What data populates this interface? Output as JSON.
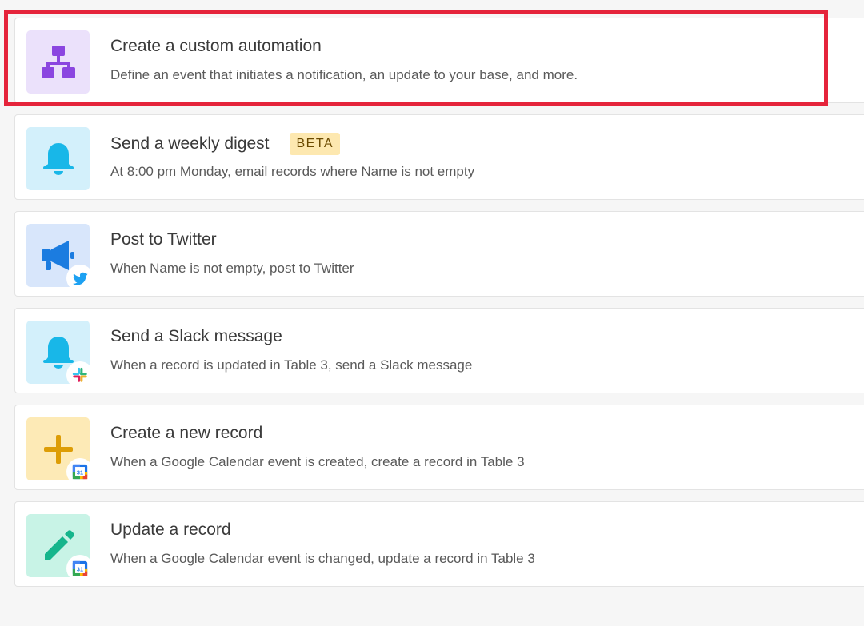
{
  "colors": {
    "page_bg": "#f6f6f6",
    "card_bg": "#ffffff",
    "highlight_border": "#e5243b",
    "beta_bg": "#fde8b0"
  },
  "automations": [
    {
      "title": "Create a custom automation",
      "description": "Define an event that initiates a notification, an update to your base, and more.",
      "icon": "flowchart-icon",
      "tile_color": "#ebe1fb",
      "icon_color": "#8b46e0",
      "highlighted": true
    },
    {
      "title": "Send a weekly digest",
      "badge": "BETA",
      "description": "At 8:00 pm Monday, email records where Name is not empty",
      "icon": "bell-icon",
      "tile_color": "#d3f0fb",
      "icon_color": "#18b7e8"
    },
    {
      "title": "Post to Twitter",
      "description": "When Name is not empty, post to Twitter",
      "icon": "megaphone-icon",
      "overlay_icon": "twitter-icon",
      "tile_color": "#d8e6fb",
      "icon_color": "#1b7ce0"
    },
    {
      "title": "Send a Slack message",
      "description": "When a record is updated in Table 3, send a Slack message",
      "icon": "bell-icon",
      "overlay_icon": "slack-icon",
      "tile_color": "#d3f0fb",
      "icon_color": "#18b7e8"
    },
    {
      "title": "Create a new record",
      "description": "When a Google Calendar event is created, create a record in Table 3",
      "icon": "plus-icon",
      "overlay_icon": "google-calendar-icon",
      "overlay_text": "31",
      "tile_color": "#fdeab6",
      "icon_color": "#dd9d06"
    },
    {
      "title": "Update a record",
      "description": "When a Google Calendar event is changed, update a record in Table 3",
      "icon": "pencil-icon",
      "overlay_icon": "google-calendar-icon",
      "overlay_text": "31",
      "tile_color": "#c8f3e6",
      "icon_color": "#16b58c"
    }
  ]
}
